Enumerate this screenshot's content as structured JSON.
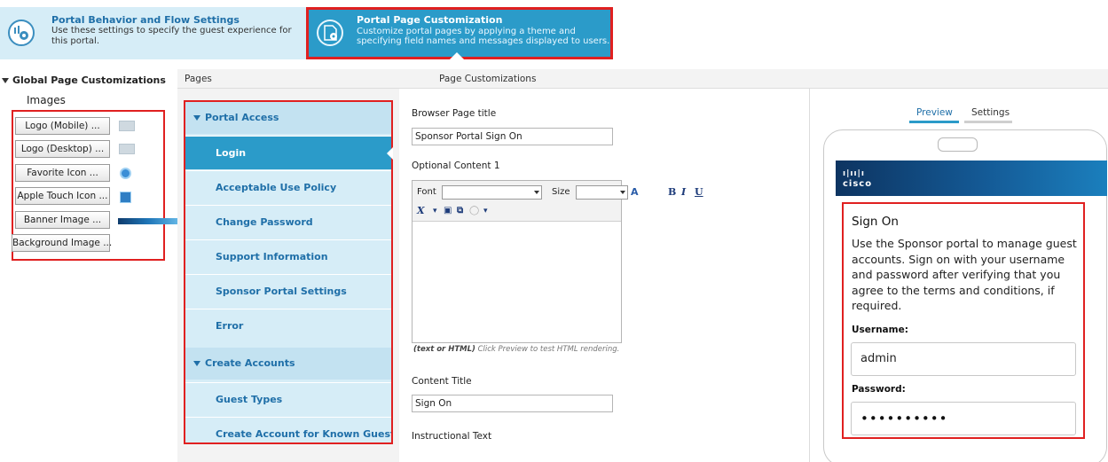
{
  "steps": {
    "behavior": {
      "title": "Portal Behavior and Flow Settings",
      "description": "Use these settings to specify the guest experience for this portal.",
      "icon": "flow-settings-icon"
    },
    "customization": {
      "title": "Portal Page Customization",
      "description": "Customize portal pages by applying a theme and specifying field names and messages displayed to users.",
      "icon": "page-settings-icon",
      "active": true
    }
  },
  "global": {
    "title": "Global Page Customizations",
    "images_label": "Images",
    "buttons": [
      {
        "label": "Logo (Mobile) ...",
        "thumb": "cisco-logo"
      },
      {
        "label": "Logo (Desktop) ...",
        "thumb": "cisco-logo"
      },
      {
        "label": "Favorite Icon ...",
        "thumb": "round-icon"
      },
      {
        "label": "Apple Touch Icon ...",
        "thumb": "square-icon"
      },
      {
        "label": "Banner Image ...",
        "thumb": "banner-strip"
      },
      {
        "label": "Background Image ...",
        "thumb": ""
      }
    ]
  },
  "header": {
    "pages": "Pages",
    "page_customizations": "Page Customizations"
  },
  "pages": {
    "sections": [
      {
        "title": "Portal Access",
        "items": [
          "Login",
          "Acceptable Use Policy",
          "Change Password",
          "Support Information",
          "Sponsor Portal Settings",
          "Error"
        ]
      },
      {
        "title": "Create Accounts",
        "items": [
          "Guest Types",
          "Create Account for Known Guests"
        ]
      }
    ],
    "active_item": "Login"
  },
  "form": {
    "browser_title_label": "Browser Page title",
    "browser_title_value": "Sponsor Portal Sign On",
    "optional_content_label": "Optional Content 1",
    "toolbar": {
      "font_label": "Font",
      "size_label": "Size",
      "bold": "B",
      "italic": "I",
      "underline": "U"
    },
    "hint_prefix": "(text or HTML)",
    "hint_text": "Click Preview to test HTML rendering.",
    "content_title_label": "Content Title",
    "content_title_value": "Sign On",
    "instructional_label": "Instructional Text"
  },
  "preview": {
    "tab_preview": "Preview",
    "tab_settings": "Settings",
    "brand": "cisco",
    "signin_title": "Sign On",
    "signin_text": "Use the Sponsor portal to manage guest accounts. Sign on with your username and password after verifying that you agree to the terms and conditions, if required.",
    "username_label": "Username:",
    "username_value": "admin",
    "password_label": "Password:",
    "password_value": "••••••••••"
  },
  "colors": {
    "accent": "#2b9bc9",
    "nav_bg": "#d6edf7",
    "highlight": "#e02020",
    "link": "#1f6fa8"
  }
}
